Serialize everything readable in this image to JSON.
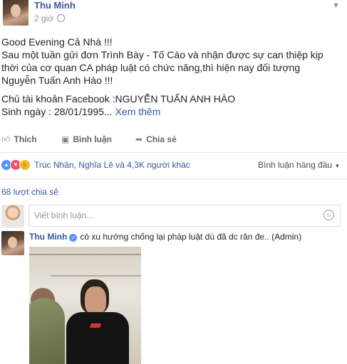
{
  "post": {
    "author": "Thu Minh",
    "time": "2 giờ",
    "body": {
      "line1": "Good Evening Cả Nhà !!!",
      "line2": "Sau một tuần gửi đơn Trình Bày - Tố Cáo và nhận được sự can thiệp kịp thời của cơ quan CA pháp luật có chức năng,thì hiện nay đối tượng Nguyễn Tuấn Anh Hào !!!",
      "line3": "Chủ tài khoản Facebook :NGUYỄN TUẤN ANH HÀO",
      "line4": "Sinh ngày : 28/01/1995...",
      "see_more": "Xem thêm"
    }
  },
  "actions": {
    "like": "Thích",
    "comment": "Bình luận",
    "share": "Chia sẻ"
  },
  "reactions": {
    "names": "Trúc Nhân, Nghĩa Lê và 4,3K người khác",
    "sort_label": "Bình luận hàng đầu"
  },
  "shares": "68 lượt chia sẻ",
  "comment_input": {
    "placeholder": "Viết bình luận..."
  },
  "comments": [
    {
      "author": "Thu Minh",
      "text": "có xu hướng chống lại pháp luật dù đã dc răn đe.. (Admin)"
    }
  ],
  "icons": {
    "like": "thumbs-up-icon",
    "comment": "comment-bubble-icon",
    "share": "share-arrow-icon",
    "privacy": "globe-icon",
    "emoji": "smiley-icon",
    "verified": "verified-badge-icon"
  },
  "colors": {
    "link": "#365899",
    "text": "#1d2129",
    "muted": "#90949c",
    "like_reaction": "#5890ff",
    "love_reaction": "#f25268",
    "haha_reaction": "#f7b928"
  }
}
